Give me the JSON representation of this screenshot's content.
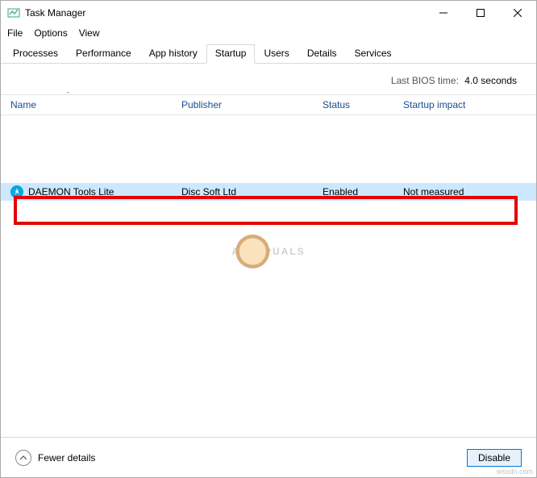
{
  "window": {
    "title": "Task Manager"
  },
  "menu": {
    "file": "File",
    "options": "Options",
    "view": "View"
  },
  "tabs": {
    "processes": "Processes",
    "performance": "Performance",
    "app_history": "App history",
    "startup": "Startup",
    "users": "Users",
    "details": "Details",
    "services": "Services"
  },
  "bios": {
    "label": "Last BIOS time:",
    "value": "4.0 seconds"
  },
  "columns": {
    "name": "Name",
    "publisher": "Publisher",
    "status": "Status",
    "impact": "Startup impact"
  },
  "rows": [
    {
      "name": "DAEMON Tools Lite",
      "publisher": "Disc Soft Ltd",
      "status": "Enabled",
      "impact": "Not measured"
    }
  ],
  "footer": {
    "fewer": "Fewer details",
    "disable": "Disable"
  },
  "watermark": {
    "left": "A",
    "right": "PUALS"
  },
  "attribution": "wsxdn.com"
}
